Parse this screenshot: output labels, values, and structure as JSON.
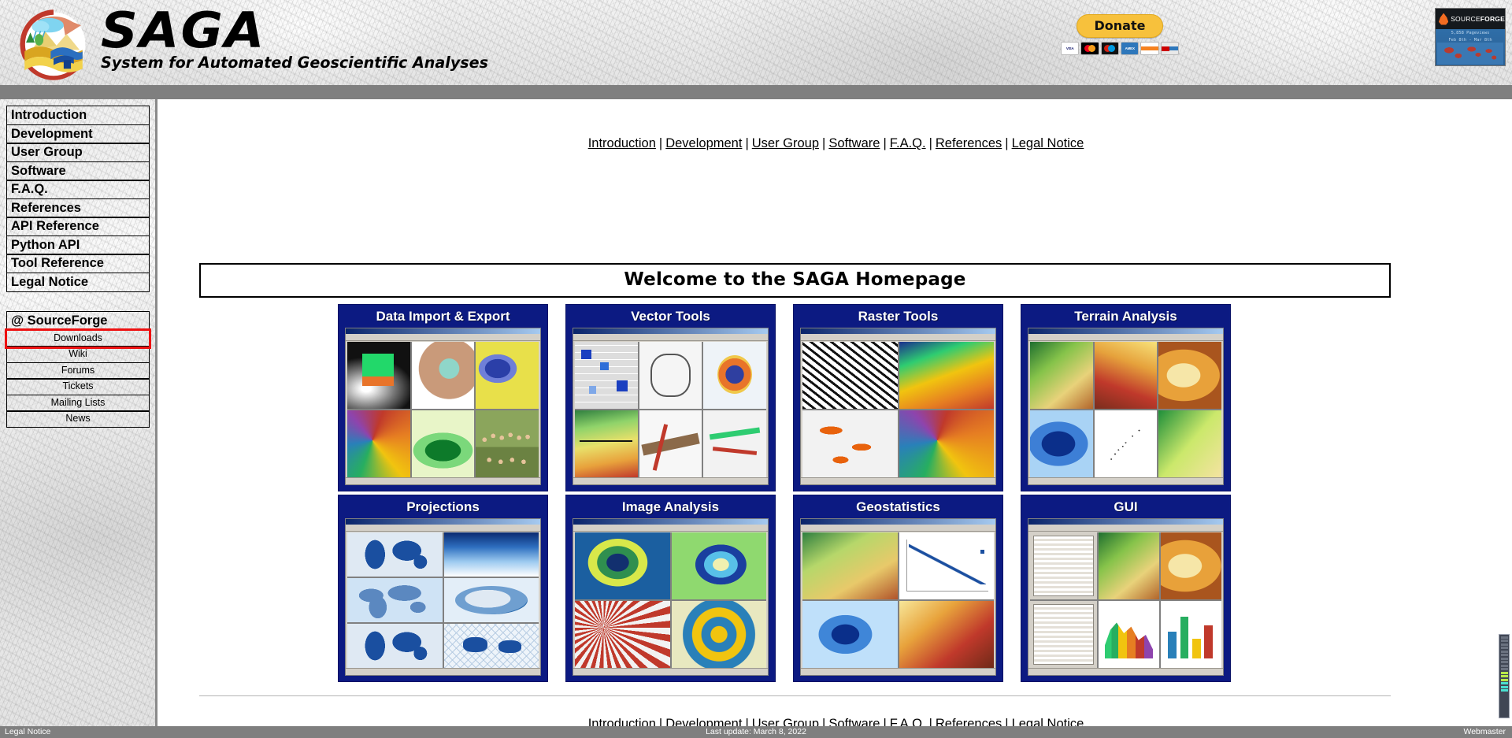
{
  "header": {
    "logo_icon": "saga-landscape-logo-icon",
    "title": "SAGA",
    "subtitle": "System for Automated Geoscientific Analyses",
    "donate": {
      "label": "Donate",
      "cards": [
        "VISA",
        "MASTER",
        "MAESTRO",
        "AMEX",
        "DISCOVER",
        "DEBIT"
      ]
    },
    "sourceforge_badge": {
      "wordmark_light": "SOURCE",
      "wordmark_bold": "FORGE",
      "stat_line_1": "5,858 Pageviews",
      "stat_line_2": "Feb 8th - Mar 8th",
      "flame_icon": "sourceforge-flame-icon"
    }
  },
  "sidebar": {
    "main_items": [
      {
        "label": "Introduction"
      },
      {
        "label": "Development"
      },
      {
        "label": "User Group"
      },
      {
        "label": "Software"
      },
      {
        "label": "F.A.Q."
      },
      {
        "label": "References"
      },
      {
        "label": "API Reference"
      },
      {
        "label": "Python API"
      },
      {
        "label": "Tool Reference"
      },
      {
        "label": "Legal Notice"
      }
    ],
    "sourceforge_header": "@ SourceForge",
    "sourceforge_items": [
      {
        "label": "Downloads",
        "highlighted": true
      },
      {
        "label": "Wiki",
        "highlighted": false
      },
      {
        "label": "Forums",
        "highlighted": false
      },
      {
        "label": "Tickets",
        "highlighted": false
      },
      {
        "label": "Mailing Lists",
        "highlighted": false
      },
      {
        "label": "News",
        "highlighted": false
      }
    ],
    "highlight_color": "#ee1111"
  },
  "main": {
    "nav_links": [
      "Introduction",
      "Development",
      "User Group",
      "Software",
      "F.A.Q.",
      "References",
      "Legal Notice"
    ],
    "nav_separator": "|",
    "welcome_title": "Welcome to the SAGA Homepage",
    "panels": [
      {
        "title": "Data Import & Export"
      },
      {
        "title": "Vector Tools"
      },
      {
        "title": "Raster Tools"
      },
      {
        "title": "Terrain Analysis"
      },
      {
        "title": "Projections"
      },
      {
        "title": "Image Analysis"
      },
      {
        "title": "Geostatistics"
      },
      {
        "title": "GUI"
      }
    ],
    "panel_background_color": "#0c1a82"
  },
  "footer": {
    "left_link": "Legal Notice",
    "center_text": "Last update: March 8, 2022",
    "right_link": "Webmaster",
    "background_color": "#7f7f7f"
  }
}
